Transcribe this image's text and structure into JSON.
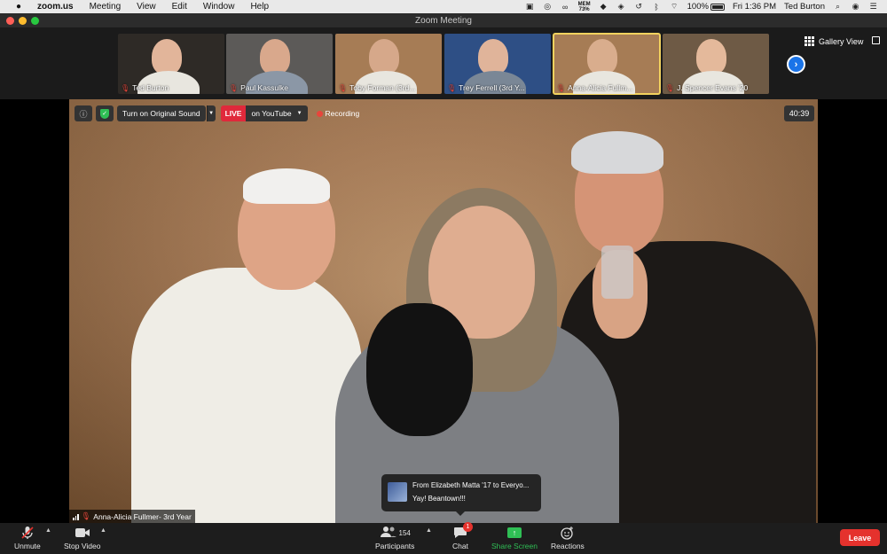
{
  "menubar": {
    "app_name": "zoom.us",
    "menus": [
      "Meeting",
      "View",
      "Edit",
      "Window",
      "Help"
    ],
    "mem_label": "MEM",
    "mem_value": "73%",
    "battery": "100%",
    "clock": "Fri 1:36 PM",
    "user": "Ted Burton"
  },
  "window": {
    "title": "Zoom Meeting"
  },
  "gallery": {
    "participants": [
      {
        "name": "Ted Burton",
        "bg": "#2e2a26",
        "skin": "#e2b59a"
      },
      {
        "name": "Paul Kassulke",
        "bg": "#5c5a58",
        "skin": "#d9a88c"
      },
      {
        "name": "Toby Forman (3rd...",
        "bg": "#a67c55",
        "skin": "#d6a88a"
      },
      {
        "name": "Trey Ferrell (3rd Y...",
        "bg": "#2e4f85",
        "skin": "#e0b49a"
      },
      {
        "name": "Anna-Alicia Fullm...",
        "bg": "#a67c55",
        "skin": "#d9ad8d"
      },
      {
        "name": "J. Spencer Evans '20",
        "bg": "#6e5a45",
        "skin": "#e4b99b"
      }
    ],
    "view_label": "Gallery View"
  },
  "video_controls": {
    "original_sound": "Turn on Original Sound",
    "live_label": "LIVE",
    "youtube_label": "on YouTube",
    "recording_label": "Recording",
    "timer": "40:39"
  },
  "speaker": {
    "name": "Anna-Alicia Fullmer- 3rd Year"
  },
  "chat_toast": {
    "from": "From Elizabeth Matta '17 to Everyo...",
    "message": "Yay!  Beantown!!!"
  },
  "toolbar": {
    "unmute": "Unmute",
    "stop_video": "Stop Video",
    "participants": "Participants",
    "participant_count": "154",
    "chat": "Chat",
    "chat_badge": "1",
    "share_screen": "Share Screen",
    "reactions": "Reactions",
    "leave": "Leave"
  },
  "colors": {
    "leave": "#e5322d",
    "share_screen": "#2fbf55",
    "active_tile": "#f2d25e",
    "live": "#e0293b"
  }
}
